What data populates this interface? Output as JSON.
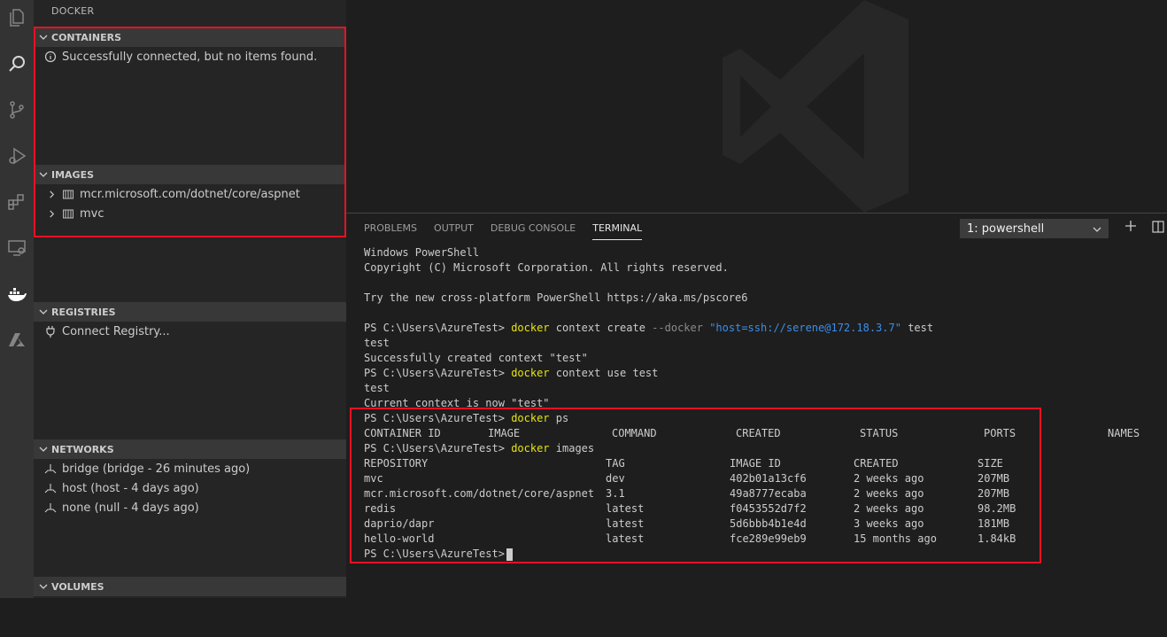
{
  "sidebar": {
    "title": "DOCKER",
    "containers": {
      "header": "CONTAINERS",
      "message": "Successfully connected, but no items found."
    },
    "images": {
      "header": "IMAGES",
      "items": [
        "mcr.microsoft.com/dotnet/core/aspnet",
        "mvc"
      ]
    },
    "registries": {
      "header": "REGISTRIES",
      "connect_label": "Connect Registry..."
    },
    "networks": {
      "header": "NETWORKS",
      "items": [
        "bridge (bridge - 26 minutes ago)",
        "host (host - 4 days ago)",
        "none (null - 4 days ago)"
      ]
    },
    "volumes": {
      "header": "VOLUMES"
    }
  },
  "panel": {
    "tabs": [
      "PROBLEMS",
      "OUTPUT",
      "DEBUG CONSOLE",
      "TERMINAL"
    ],
    "active_tab": "TERMINAL",
    "terminal_select": "1: powershell"
  },
  "terminal": {
    "line1": "Windows PowerShell",
    "line2": "Copyright (C) Microsoft Corporation. All rights reserved.",
    "line3": "Try the new cross-platform PowerShell https://aka.ms/pscore6",
    "prompt": "PS C:\\Users\\AzureTest>",
    "cmd1_docker": "docker",
    "cmd1_rest": "context create",
    "cmd1_flag": "--docker",
    "cmd1_str": "\"host=ssh://serene@172.18.3.7\"",
    "cmd1_name": "test",
    "out1a": "test",
    "out1b": "Successfully created context \"test\"",
    "cmd2_rest": "context use test",
    "out2a": "test",
    "out2b": "Current context is now \"test\"",
    "cmd3_rest": "ps",
    "ps_headers": [
      "CONTAINER ID",
      "IMAGE",
      "COMMAND",
      "CREATED",
      "STATUS",
      "PORTS",
      "NAMES"
    ],
    "cmd4_rest": "images",
    "img_headers": [
      "REPOSITORY",
      "TAG",
      "IMAGE ID",
      "CREATED",
      "SIZE"
    ],
    "img_rows": [
      [
        "mvc",
        "dev",
        "402b01a13cf6",
        "2 weeks ago",
        "207MB"
      ],
      [
        "mcr.microsoft.com/dotnet/core/aspnet",
        "3.1",
        "49a8777ecaba",
        "2 weeks ago",
        "207MB"
      ],
      [
        "redis",
        "latest",
        "f0453552d7f2",
        "2 weeks ago",
        "98.2MB"
      ],
      [
        "daprio/dapr",
        "latest",
        "5d6bbb4b1e4d",
        "3 weeks ago",
        "181MB"
      ],
      [
        "hello-world",
        "latest",
        "fce289e99eb9",
        "15 months ago",
        "1.84kB"
      ]
    ]
  },
  "colors": {
    "highlight_box": "#e81123",
    "docker_keyword": "#e5e510",
    "string": "#3b8eea"
  }
}
